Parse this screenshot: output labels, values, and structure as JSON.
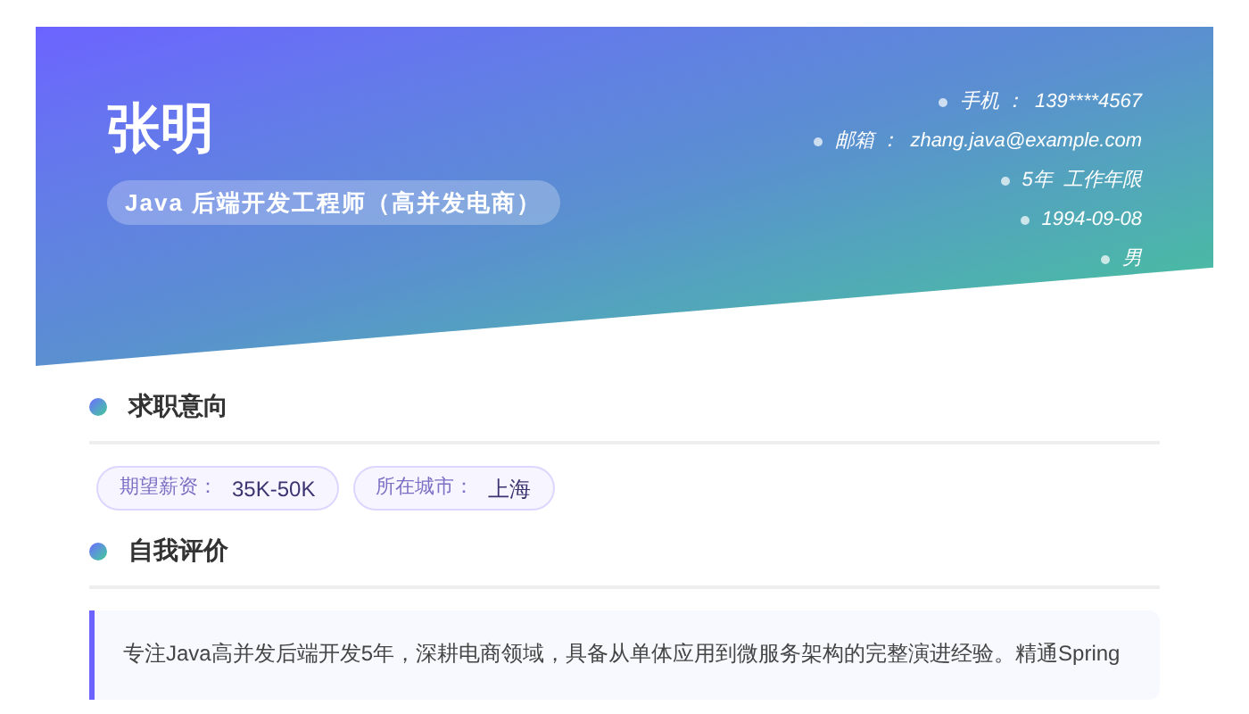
{
  "header": {
    "name": "张明",
    "title": "Java 后端开发工程师（高并发电商）",
    "contacts": [
      "手机 ：  139****4567",
      "邮箱 ：  zhang.java@example.com",
      "5年  工作年限",
      "1994-09-08",
      "男"
    ]
  },
  "sections": [
    {
      "kind": "tags",
      "title": "求职意向",
      "tags": [
        {
          "label": "期望薪资：",
          "value": "35K-50K"
        },
        {
          "label": "所在城市：",
          "value": "上海"
        }
      ]
    },
    {
      "kind": "text",
      "title": "自我评价",
      "text": "专注Java高并发后端开发5年，深耕电商领域，具备从单体应用到微服务架构的完整演进经验。精通Spring"
    }
  ]
}
